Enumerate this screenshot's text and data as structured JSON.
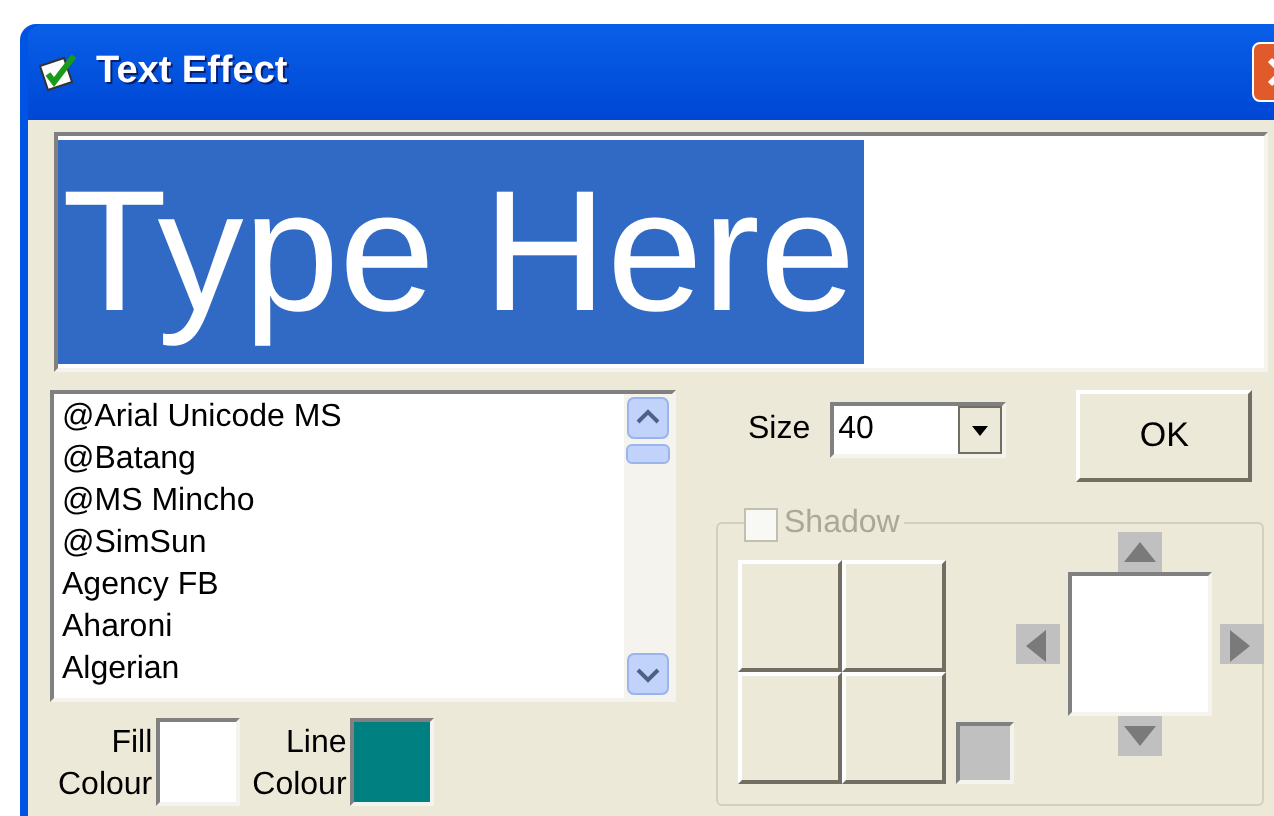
{
  "window": {
    "title": "Text Effect"
  },
  "preview": {
    "text": "Type Here",
    "selected": true
  },
  "font_list": {
    "items": [
      {
        "label": "@Arial Unicode MS",
        "selected": false
      },
      {
        "label": "@Batang",
        "selected": false
      },
      {
        "label": "@MS Mincho",
        "selected": false
      },
      {
        "label": "@SimSun",
        "selected": false
      },
      {
        "label": "Agency FB",
        "selected": false
      },
      {
        "label": "Aharoni",
        "selected": false
      },
      {
        "label": "Algerian",
        "selected": false
      }
    ]
  },
  "size": {
    "label": "Size",
    "value": "40"
  },
  "ok_button": "OK",
  "shadow": {
    "label": "Shadow",
    "checked": false,
    "disabled": true
  },
  "colours": [
    {
      "label_1": "Fill",
      "label_2": "Colour",
      "color": "#ffffff"
    },
    {
      "label_1": "Line",
      "label_2": "Colour",
      "color": "#008080"
    }
  ]
}
